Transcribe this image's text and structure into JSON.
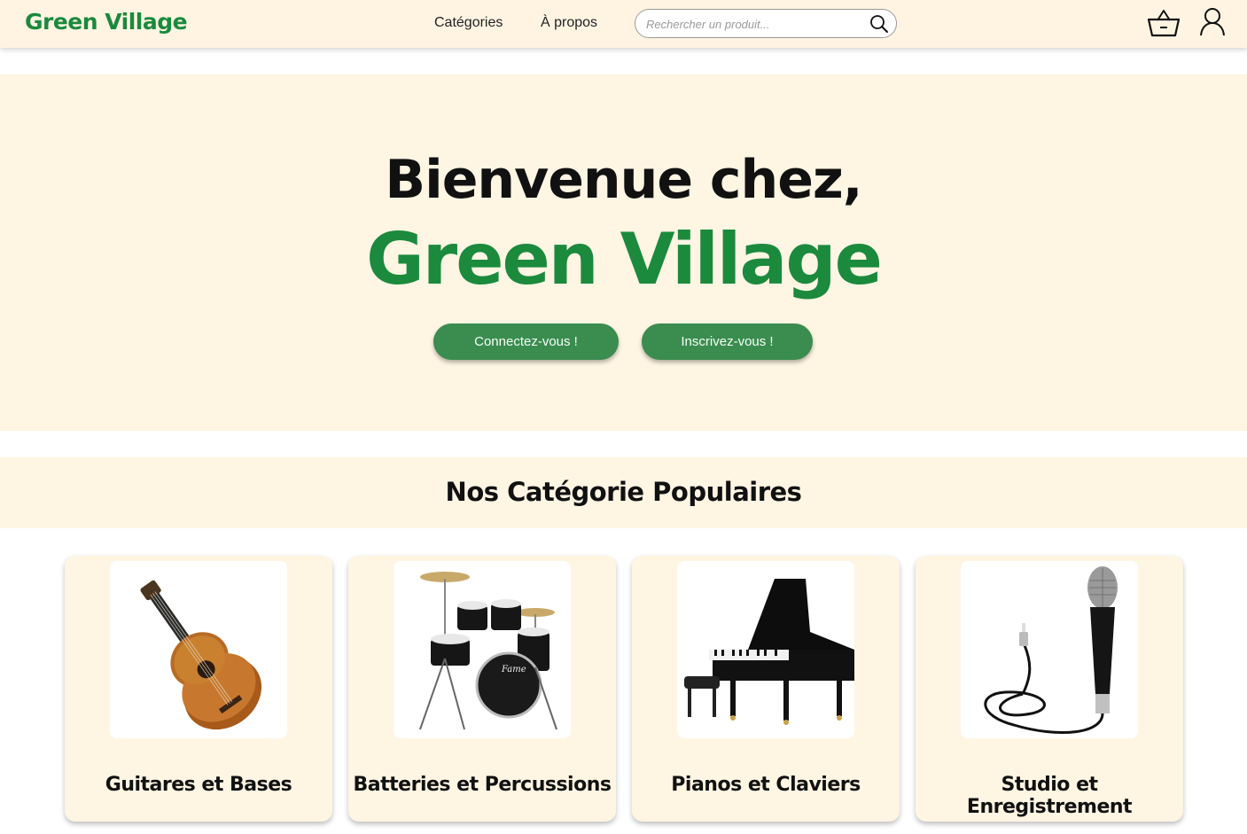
{
  "navbar": {
    "brand": "Green Village",
    "links": [
      "Catégories",
      "À propos"
    ],
    "search_placeholder": "Rechercher un produit...",
    "search_icon": "search-icon",
    "basket_icon": "basket-icon",
    "user_icon": "user-icon"
  },
  "hero": {
    "welcome": "Bienvenue chez,",
    "brand": "Green Village",
    "login_label": "Connectez-vous !",
    "signup_label": "Inscrivez-vous !"
  },
  "categories": {
    "title": "Nos Catégorie Populaires",
    "items": [
      {
        "label": "Guitares et Bases",
        "image": "guitar-image"
      },
      {
        "label": "Batteries et Percussions",
        "image": "drum-kit-image"
      },
      {
        "label": "Pianos et Claviers",
        "image": "grand-piano-image"
      },
      {
        "label": "Studio et Enregistrement",
        "image": "microphone-image"
      }
    ]
  },
  "colors": {
    "brand_green": "#1b8a3d",
    "button_green": "#3a8c4f",
    "cream": "#fef5e3"
  }
}
